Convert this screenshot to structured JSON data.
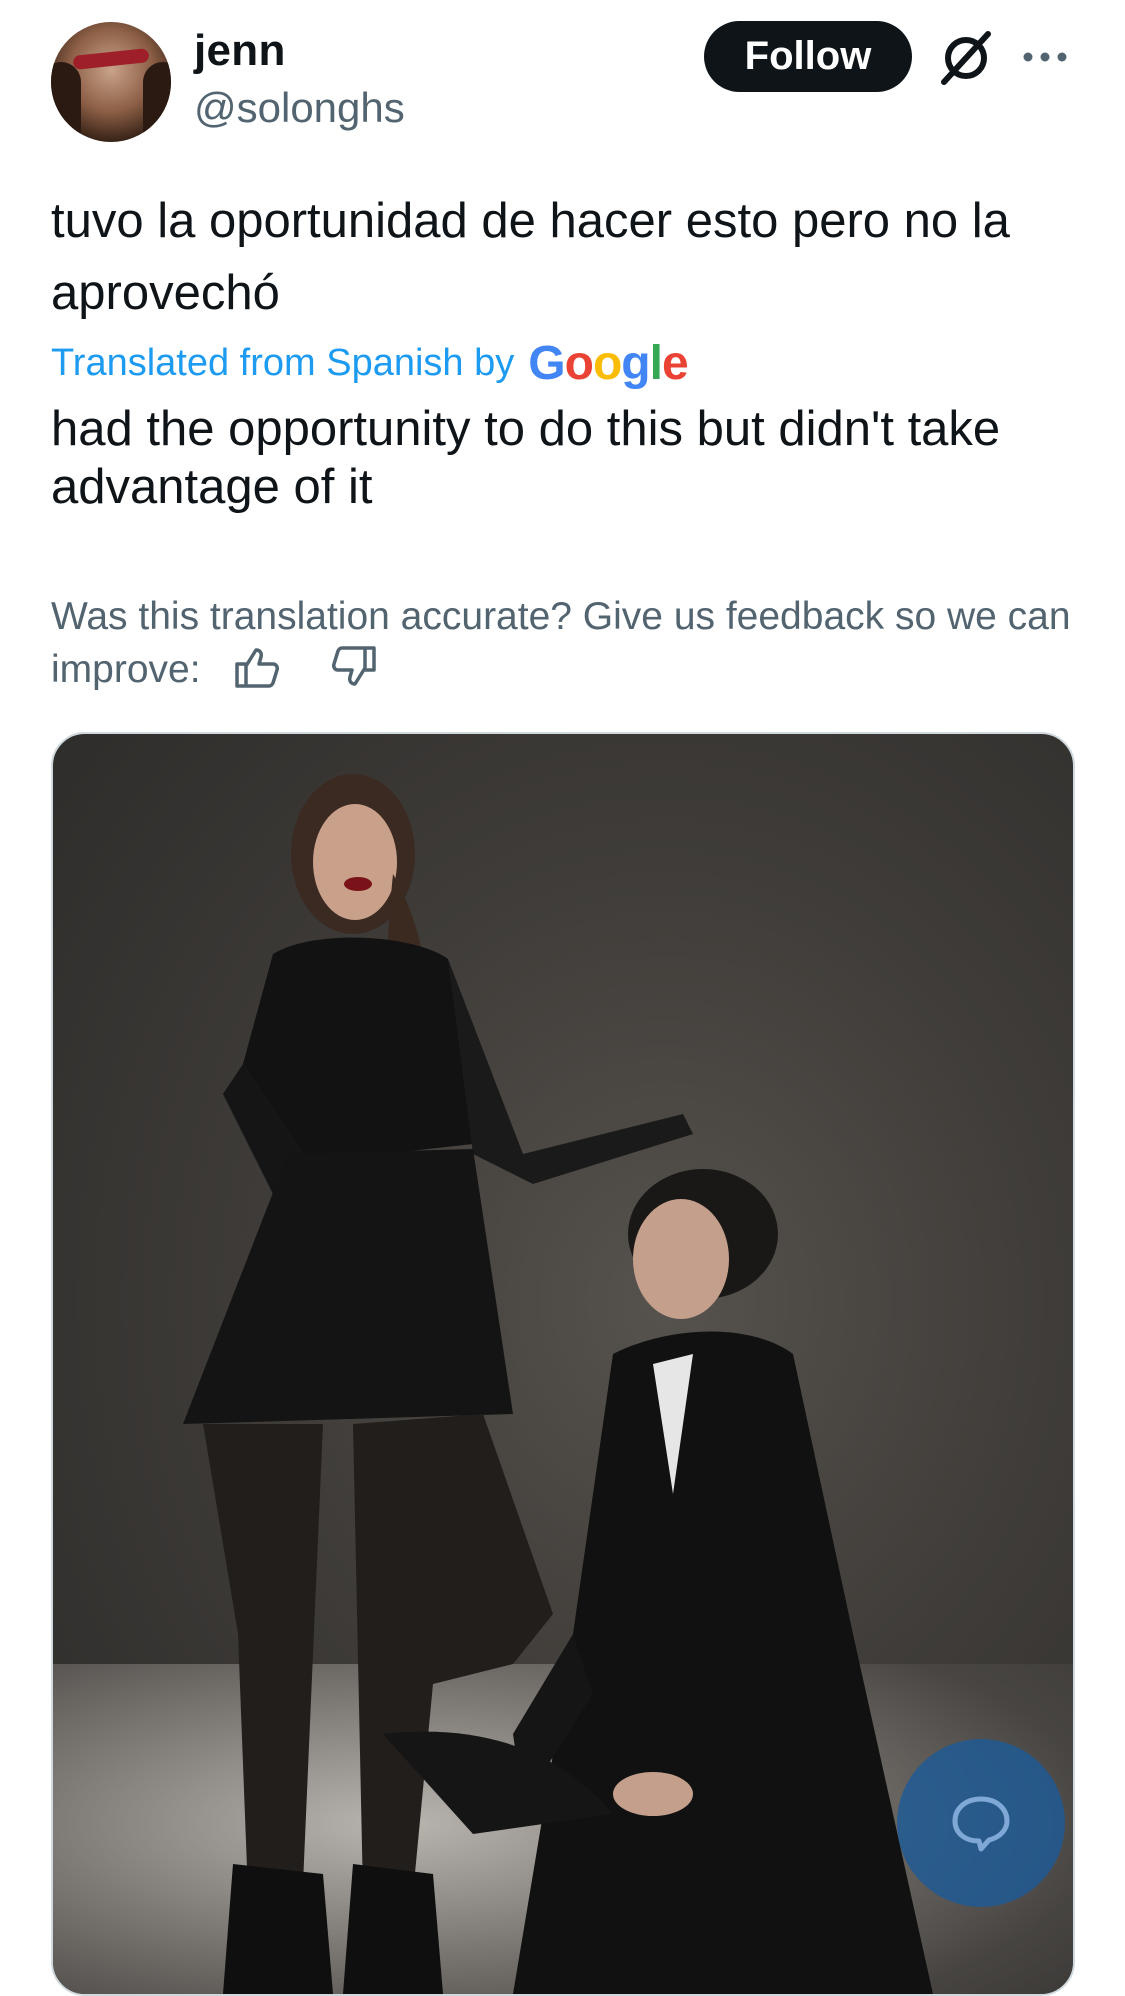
{
  "author": {
    "display_name": "jenn",
    "handle": "@solonghs"
  },
  "actions": {
    "follow_label": "Follow",
    "grok_icon": "grok-icon",
    "more_icon": "more-icon"
  },
  "tweet": {
    "text": "tuvo la oportunidad de hacer esto pero no la aprovechó",
    "translated_label": "Translated from Spanish by",
    "translator_logo": "Google",
    "translation": "had the opportunity to do this but didn't take advantage of it",
    "feedback_prompt": "Was this translation accurate? Give us feedback so we can improve:"
  },
  "colors": {
    "link_blue": "#1d9bf0",
    "follow_bg": "#0f1419",
    "muted_text": "#536471"
  }
}
